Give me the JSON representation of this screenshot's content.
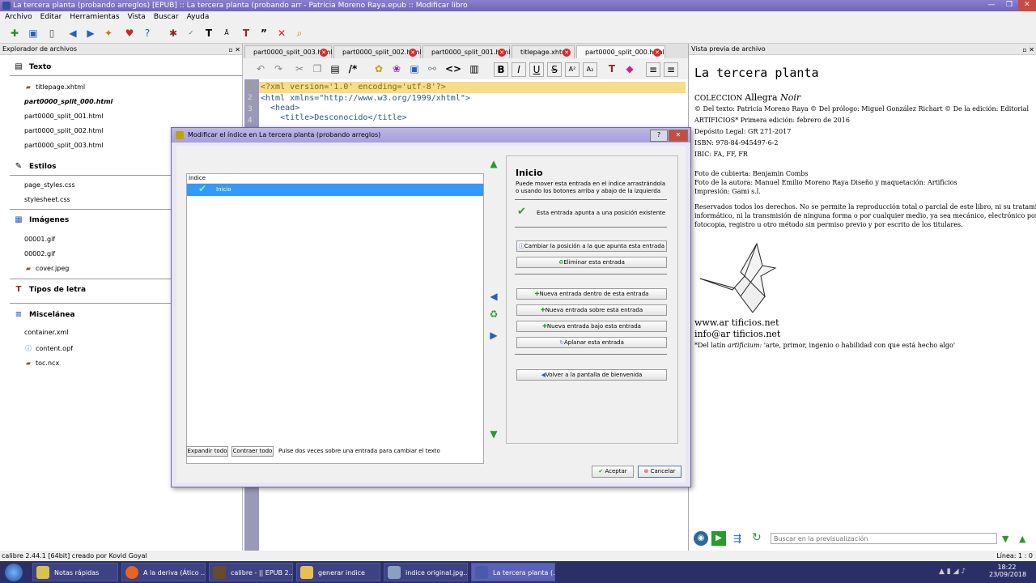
{
  "window": {
    "title": "La tercera planta (probando arreglos) [EPUB] :: La tercera planta (probando arr - Patricia Moreno Raya.epub :: Modificar libro",
    "min": "—",
    "max": "❐",
    "close": "✕"
  },
  "menu": [
    "Archivo",
    "Editar",
    "Herramientas",
    "Vista",
    "Buscar",
    "Ayuda"
  ],
  "explorer": {
    "title": "Explorador de archivos",
    "sections": {
      "texto": {
        "label": "Texto",
        "items": [
          "titlepage.xhtml",
          "part0000_split_000.html",
          "part0000_split_001.html",
          "part0000_split_002.html",
          "part0000_split_003.html"
        ]
      },
      "estilos": {
        "label": "Estilos",
        "items": [
          "page_styles.css",
          "stylesheet.css"
        ]
      },
      "imagenes": {
        "label": "Imágenes",
        "items": [
          "00001.gif",
          "00002.gif",
          "cover.jpeg"
        ]
      },
      "tipos": {
        "label": "Tipos de letra"
      },
      "misc": {
        "label": "Miscelánea",
        "items": [
          "container.xml",
          "content.opf",
          "toc.ncx"
        ]
      }
    }
  },
  "editor": {
    "tabs": [
      "part0000_split_003.html",
      "part0000_split_002.html",
      "part0000_split_001.html",
      "titlepage.xhtml",
      "part0000_split_000.html"
    ],
    "code": [
      "<?xml version='1.0' encoding='utf-8'?>",
      "<html xmlns=\"http://www.w3.org/1999/xhtml\">",
      "  <head>",
      "    <title>Desconocido</title>"
    ],
    "line_numbers": [
      "1",
      "2",
      "3",
      "4"
    ]
  },
  "preview": {
    "title": "Vista previa de archivo",
    "book_title": "La tercera planta",
    "collection_prefix": "COLECCION ",
    "collection_name": "Allegra ",
    "collection_italic": "Noir",
    "lines": [
      "© Del texto: Patricia Moreno Raya © Del prólogo: Miguel González Richart © De la edición: Editorial",
      "ARTIFICIOS* Primera edición: febrero de 2016",
      "Depósito Legal: GR 271-2017",
      "ISBN: 978-84-945497-6-2",
      "IBIC: FA, FF, FR",
      "Foto de cubierta: Benjamin Combs",
      "Foto de la autora: Manuel Emilio Moreno Raya Diseño y maquetación: Artificios",
      "Impresión: Gami s.l.",
      "Reservados todos los derechos. No se permite la reproducción total o parcial de este libro, ni su tratamiento",
      "informático, ni la transmisión de ninguna forma o por cualquier medio, ya sea mecánico, electrónico por",
      "fotocopia, registro u otro método sin permiso previo y por escrito de los titulares."
    ],
    "web": "www.ar tificios.net",
    "email": "info@ar tificios.net",
    "footnote_pre": "*Del latín ",
    "footnote_italic": "artificium:",
    "footnote_post": " 'arte, primor, ingenio o habilidad con que está hecho algo'",
    "search_placeholder": "Buscar en la previsualización"
  },
  "status": {
    "left": "calibre 2.44.1 [64bit] creado por Kovid Goyal",
    "right": "Línea: 1 : 0"
  },
  "dialog": {
    "title": "Modificar el índice en La tercera planta (probando arreglos)",
    "help": "?",
    "close": "✕",
    "tree_header": "Índice",
    "tree_item": "Inicio",
    "entry_title": "Inicio",
    "entry_desc": "Puede mover esta entrada en el índice arrastrándola o usando los botones arriba y abajo de la izquierda",
    "entry_status": "Esta entrada apunta a una posición existente",
    "btn_change": "Cambiar la posición a la que apunta esta entrada",
    "btn_delete": "Eliminar esta entrada",
    "btn_new_inside": "Nueva entrada dentro de esta entrada",
    "btn_new_above": "Nueva entrada sobre esta entrada",
    "btn_new_below": "Nueva entrada bajo esta entrada",
    "btn_flatten": "Aplanar esta entrada",
    "btn_back": "Volver a la pantalla de bienvenida",
    "expand_all": "Expandir todo",
    "collapse_all": "Contraer todo",
    "hint": "Pulse dos veces sobre una entrada para cambiar el texto",
    "accept": "Aceptar",
    "cancel": "Cancelar"
  },
  "taskbar": {
    "tasks": [
      "Notas rápidas",
      "A la deriva (Ático ...",
      "calibre - || EPUB 2...",
      "generar indice",
      "indice original.jpg...",
      "La tercera planta (..."
    ],
    "time": "18:22",
    "date": "23/09/2018"
  },
  "colors": {
    "accent": "#6f64b8",
    "selection": "#3399ff",
    "highlight_line": "#f7dc8a",
    "taskbar": "#2a2f66"
  }
}
